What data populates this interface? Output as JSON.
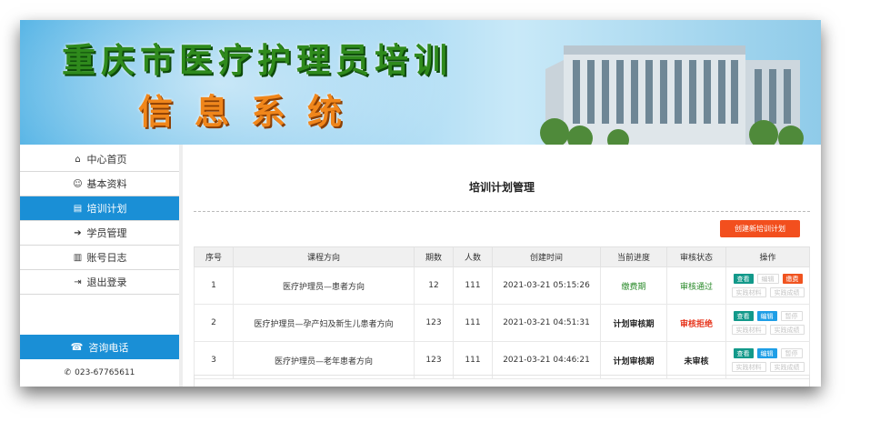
{
  "banner": {
    "title_line1": "重庆市医疗护理员培训",
    "title_line2": "信息系统"
  },
  "sidebar": {
    "items": [
      {
        "label": "中心首页",
        "icon": "home-icon"
      },
      {
        "label": "基本资料",
        "icon": "user-icon"
      },
      {
        "label": "培训计划",
        "icon": "document-icon",
        "active": true
      },
      {
        "label": "学员管理",
        "icon": "arrow-right-icon"
      },
      {
        "label": "账号日志",
        "icon": "log-icon"
      },
      {
        "label": "退出登录",
        "icon": "logout-icon"
      }
    ],
    "phone_header": "咨询电话",
    "phone_number": "023-67765611"
  },
  "main": {
    "title": "培训计划管理",
    "create_button": "创建新培训计划",
    "table": {
      "headers": [
        "序号",
        "课程方向",
        "期数",
        "人数",
        "创建时间",
        "当前进度",
        "审核状态",
        "操作"
      ],
      "rows": [
        {
          "no": "1",
          "course": "医疗护理员—患者方向",
          "term": "12",
          "people": "111",
          "created": "2021-03-21 05:15:26",
          "progress": "缴费期",
          "status": "审核通过"
        },
        {
          "no": "2",
          "course": "医疗护理员—孕产妇及新生儿患者方向",
          "term": "123",
          "people": "111",
          "created": "2021-03-21 04:51:31",
          "progress": "计划审核期",
          "status": "审核拒绝"
        },
        {
          "no": "3",
          "course": "医疗护理员—老年患者方向",
          "term": "123",
          "people": "111",
          "created": "2021-03-21 04:46:21",
          "progress": "计划审核期",
          "status": "未审核"
        }
      ]
    },
    "ops": {
      "view": "查看",
      "edit": "编辑",
      "pay": "缴费",
      "pause": "暂停",
      "practical_material": "实践材料",
      "practical_score": "实践成绩"
    }
  },
  "colors": {
    "accent": "#1a8fd6",
    "create_button": "#f24f1e",
    "view_button": "#12998a",
    "edit_button": "#1e9ee6",
    "pay_button": "#f0531f"
  }
}
